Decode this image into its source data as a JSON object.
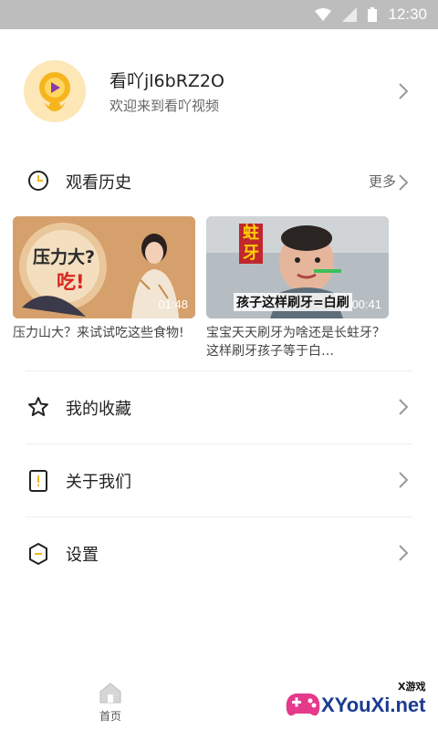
{
  "status_bar": {
    "time": "12:30"
  },
  "profile": {
    "username": "看吖jl6bRZ2O",
    "welcome": "欢迎来到看吖视频"
  },
  "history": {
    "title": "观看历史",
    "more_label": "更多",
    "videos": [
      {
        "title": "压力山大？来试试吃这些食物!",
        "duration": "01:48",
        "thumb_text_top": "压力大?",
        "thumb_text_bottom": "吃!"
      },
      {
        "title": "宝宝天天刷牙为啥还是长蛀牙？这样刷牙孩子等于白…",
        "duration": "00:41",
        "thumb_text_top": "蛀牙",
        "thumb_caption": "孩子这样刷牙=白刷"
      }
    ]
  },
  "menu": {
    "favorites": "我的收藏",
    "about": "关于我们",
    "settings": "设置"
  },
  "bottom_nav": {
    "home": "首页"
  },
  "watermark": {
    "brand": "XYouXi.net",
    "small": "X游戏"
  },
  "colors": {
    "accent": "#f5b821",
    "status_bar": "#bdbdbd",
    "text": "#222222"
  }
}
